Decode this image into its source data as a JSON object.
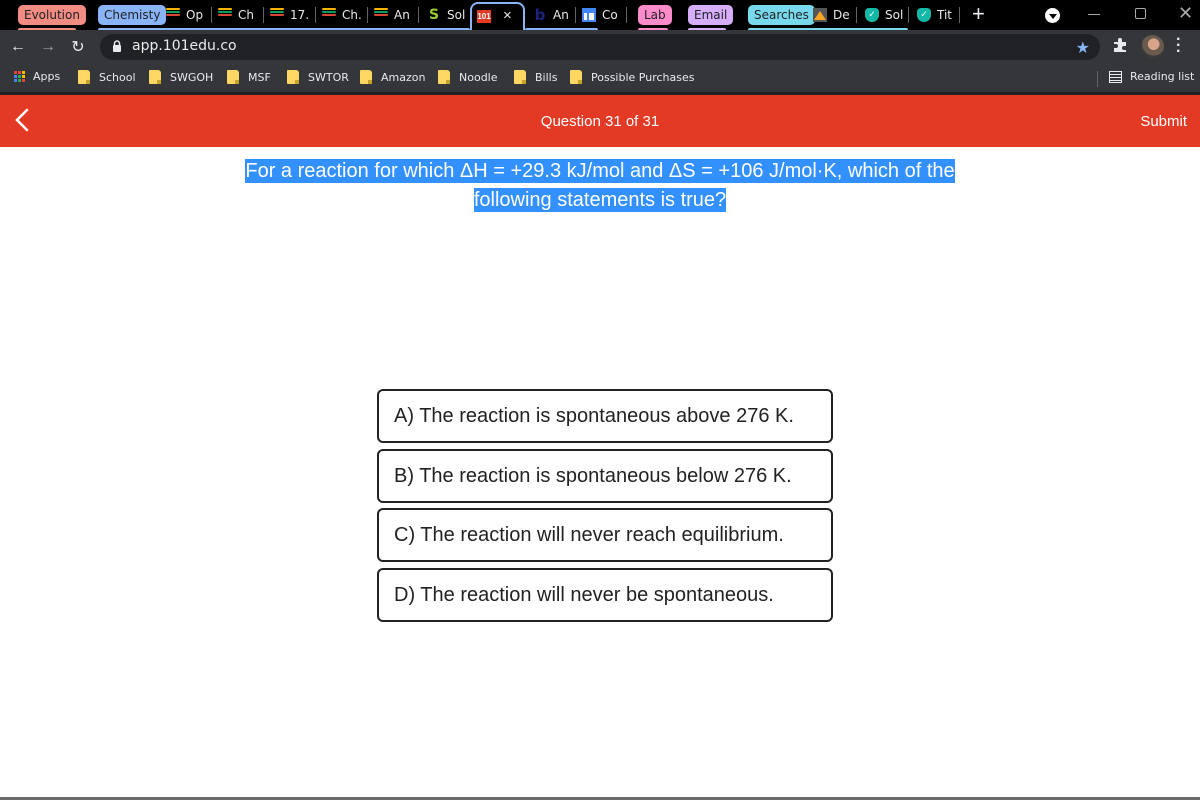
{
  "browser": {
    "tab_groups": [
      {
        "label": "Evolution",
        "color": "#f28b82"
      },
      {
        "label": "Chemisty",
        "color": "#8ab4f8"
      },
      {
        "label": "Lab",
        "color": "#ff8bcb"
      },
      {
        "label": "Email",
        "color": "#d7aefb"
      },
      {
        "label": "Searches",
        "color": "#78d9ec"
      }
    ],
    "tabs": [
      {
        "title": "Op",
        "icon": "stack-icon"
      },
      {
        "title": "Ch",
        "icon": "stack-icon"
      },
      {
        "title": "17.",
        "icon": "stack-icon"
      },
      {
        "title": "Ch.",
        "icon": "stack-icon"
      },
      {
        "title": "An",
        "icon": "stack-icon"
      },
      {
        "title": "Sol",
        "icon": "s-logo-icon"
      },
      {
        "title": "",
        "icon": "101edu-icon",
        "active": true
      },
      {
        "title": "An",
        "icon": "bartleby-icon"
      },
      {
        "title": "Co",
        "icon": "layout-icon"
      },
      {
        "title": "De",
        "icon": "desmos-icon"
      },
      {
        "title": "Sol",
        "icon": "shield-check-icon"
      },
      {
        "title": "Tit",
        "icon": "shield-check-icon"
      }
    ],
    "new_tab_label": "+",
    "close_tab_label": "×",
    "url": "app.101edu.co",
    "bookmarks": [
      {
        "label": "Apps",
        "icon": "apps-grid-icon"
      },
      {
        "label": "School",
        "icon": "folder-icon"
      },
      {
        "label": "SWGOH",
        "icon": "folder-icon"
      },
      {
        "label": "MSF",
        "icon": "folder-icon"
      },
      {
        "label": "SWTOR",
        "icon": "folder-icon"
      },
      {
        "label": "Amazon",
        "icon": "folder-icon"
      },
      {
        "label": "Noodle",
        "icon": "folder-icon"
      },
      {
        "label": "Bills",
        "icon": "folder-icon"
      },
      {
        "label": "Possible Purchases",
        "icon": "folder-icon"
      }
    ],
    "reading_list_label": "Reading list"
  },
  "app": {
    "header_color": "#e33a26",
    "question_counter": "Question 31 of 31",
    "submit_label": "Submit",
    "question_lines": [
      "For a reaction for which ΔH = +29.3 kJ/mol and ΔS = +106 J/mol·K, which of the",
      "following statements is true?"
    ],
    "options": [
      {
        "letter": "A",
        "text": "A) The reaction is spontaneous above 276 K."
      },
      {
        "letter": "B",
        "text": "B) The reaction is spontaneous below 276 K."
      },
      {
        "letter": "C",
        "text": "C) The reaction will never reach equilibrium."
      },
      {
        "letter": "D",
        "text": "D) The reaction will never be spontaneous."
      }
    ]
  }
}
